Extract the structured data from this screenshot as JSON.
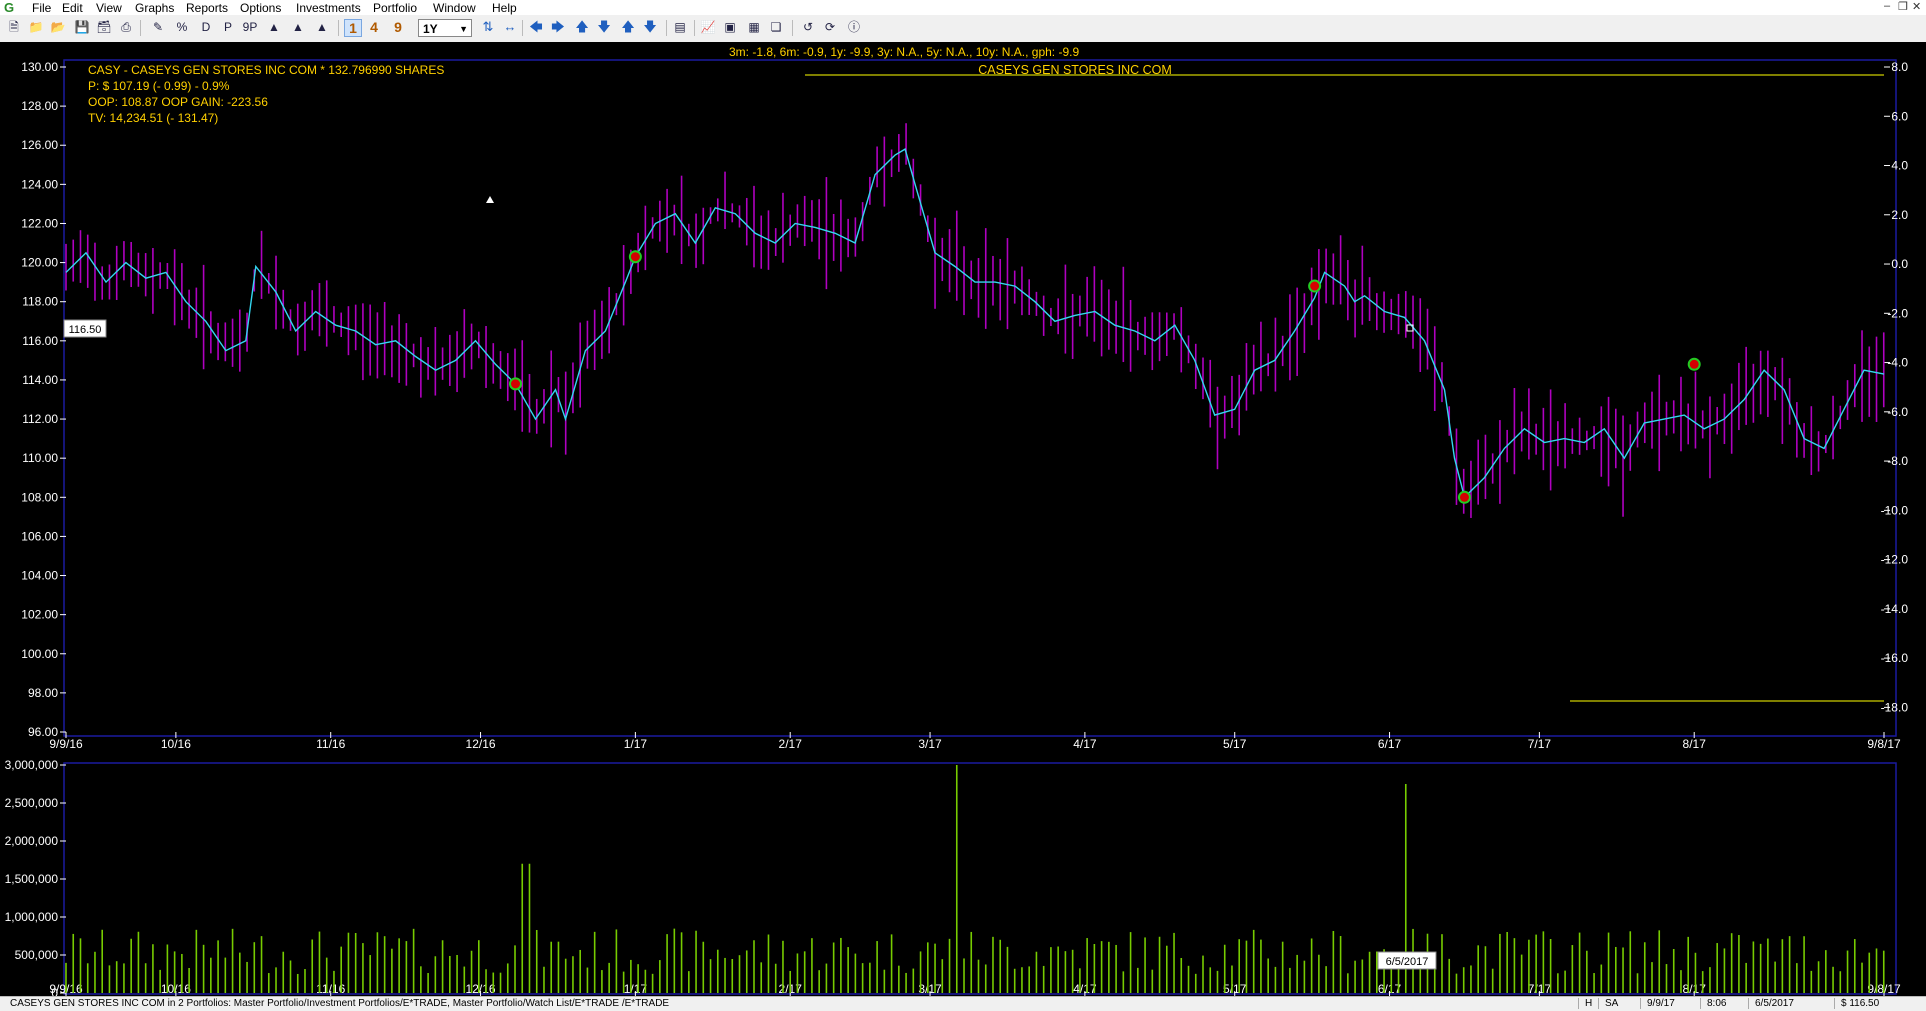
{
  "menu": {
    "items": [
      "File",
      "Edit",
      "View",
      "Graphs",
      "Reports",
      "Options",
      "Investments",
      "Portfolio",
      "Window",
      "Help"
    ],
    "logo": "G"
  },
  "toolbar": {
    "period_buttons": [
      "1",
      "4",
      "9"
    ],
    "period_select": "1Y"
  },
  "header": {
    "returns_line": "3m: -1.8,    6m: -0.9,    1y: -9.9,    3y: N.A.,    5y: N.A.,    10y: N.A.,    gph: -9.9",
    "security_title": "CASEYS GEN STORES INC COM",
    "info_line1": "CASY - CASEYS GEN STORES INC COM * 132.796990 SHARES",
    "info_line2": "P: $ 107.19 (- 0.99)  - 0.9%",
    "info_line3": "OOP:  108.87  OOP GAIN: -223.56",
    "info_line4": "TV: 14,234.51 (- 131.47)"
  },
  "price_label": "116.50",
  "date_label": "6/5/2017",
  "chart_data": {
    "type": "line",
    "title": "CASEYS GEN STORES INC COM",
    "left_axis_ticks": [
      "130.00",
      "128.00",
      "126.00",
      "124.00",
      "122.00",
      "120.00",
      "118.00",
      "116.00",
      "114.00",
      "112.00",
      "110.00",
      "108.00",
      "106.00",
      "104.00",
      "102.00",
      "100.00",
      "98.00",
      "96.00"
    ],
    "right_axis_ticks": [
      "8.0",
      "6.0",
      "4.0",
      "2.0",
      "0.0",
      "-2.0",
      "-4.0",
      "-6.0",
      "-8.0",
      "-10.0",
      "-12.0",
      "-14.0",
      "-16.0",
      "-18.0"
    ],
    "x_ticks": [
      "9/9/16",
      "10/16",
      "11/16",
      "12/16",
      "1/17",
      "2/17",
      "3/17",
      "4/17",
      "5/17",
      "6/17",
      "7/17",
      "8/17",
      "9/8/17"
    ],
    "volume_ticks": [
      "3,000,000",
      "2,500,000",
      "2,000,000",
      "1,500,000",
      "1,000,000",
      "500,000",
      "0"
    ],
    "ylim": [
      96,
      130
    ],
    "right_ylim": [
      -19,
      8
    ],
    "volume_ylim": [
      0,
      3000000
    ],
    "day_range": [
      0,
      364
    ],
    "price_series": {
      "name": "CASY",
      "points": [
        [
          0,
          119.5
        ],
        [
          4,
          120.5
        ],
        [
          8,
          119.0
        ],
        [
          12,
          120.0
        ],
        [
          16,
          119.2
        ],
        [
          20,
          119.5
        ],
        [
          24,
          118.0
        ],
        [
          28,
          117.0
        ],
        [
          32,
          115.5
        ],
        [
          36,
          116.0
        ],
        [
          38,
          119.8
        ],
        [
          42,
          118.5
        ],
        [
          46,
          116.5
        ],
        [
          50,
          117.5
        ],
        [
          54,
          116.8
        ],
        [
          58,
          116.5
        ],
        [
          62,
          115.8
        ],
        [
          66,
          116.0
        ],
        [
          70,
          115.2
        ],
        [
          74,
          114.5
        ],
        [
          78,
          115.0
        ],
        [
          82,
          116.0
        ],
        [
          86,
          114.8
        ],
        [
          90,
          113.8
        ],
        [
          94,
          112.0
        ],
        [
          98,
          113.5
        ],
        [
          100,
          112.0
        ],
        [
          104,
          115.5
        ],
        [
          108,
          116.5
        ],
        [
          112,
          119.0
        ],
        [
          114,
          120.3
        ],
        [
          118,
          122.0
        ],
        [
          122,
          122.5
        ],
        [
          126,
          121.0
        ],
        [
          130,
          122.8
        ],
        [
          134,
          122.5
        ],
        [
          138,
          121.5
        ],
        [
          142,
          121.0
        ],
        [
          146,
          122.0
        ],
        [
          150,
          121.8
        ],
        [
          154,
          121.5
        ],
        [
          158,
          121.0
        ],
        [
          162,
          124.5
        ],
        [
          166,
          125.5
        ],
        [
          168,
          125.8
        ],
        [
          170,
          124.0
        ],
        [
          174,
          120.5
        ],
        [
          178,
          119.8
        ],
        [
          182,
          119.0
        ],
        [
          186,
          119.0
        ],
        [
          190,
          118.8
        ],
        [
          194,
          118.0
        ],
        [
          198,
          117.0
        ],
        [
          202,
          117.3
        ],
        [
          206,
          117.5
        ],
        [
          210,
          116.8
        ],
        [
          214,
          116.5
        ],
        [
          218,
          116.0
        ],
        [
          222,
          116.8
        ],
        [
          226,
          115.0
        ],
        [
          230,
          112.2
        ],
        [
          234,
          112.5
        ],
        [
          238,
          114.5
        ],
        [
          242,
          115.0
        ],
        [
          246,
          116.5
        ],
        [
          250,
          118.2
        ],
        [
          252,
          119.5
        ],
        [
          256,
          118.8
        ],
        [
          258,
          118.0
        ],
        [
          260,
          118.3
        ],
        [
          264,
          117.5
        ],
        [
          268,
          117.2
        ],
        [
          272,
          116.0
        ],
        [
          276,
          113.5
        ],
        [
          278,
          110.0
        ],
        [
          280,
          108.0
        ],
        [
          284,
          109.0
        ],
        [
          288,
          110.5
        ],
        [
          292,
          111.5
        ],
        [
          296,
          110.8
        ],
        [
          300,
          111.0
        ],
        [
          304,
          110.8
        ],
        [
          308,
          111.5
        ],
        [
          312,
          110.0
        ],
        [
          316,
          111.8
        ],
        [
          320,
          112.0
        ],
        [
          324,
          112.2
        ],
        [
          328,
          111.5
        ],
        [
          332,
          112.0
        ],
        [
          336,
          113.0
        ],
        [
          340,
          114.5
        ],
        [
          344,
          113.5
        ],
        [
          348,
          111.0
        ],
        [
          352,
          110.5
        ],
        [
          356,
          112.5
        ],
        [
          360,
          114.5
        ],
        [
          364,
          114.3
        ]
      ],
      "color": "#33d6f0"
    },
    "volume_series": {
      "name": "Volume",
      "color": "#77cc00"
    },
    "range_bars_color": "#b000c0",
    "zero_line_color": "#cccc00",
    "markers": [
      {
        "x": 90,
        "y": 113.8
      },
      {
        "x": 114,
        "y": 120.3
      },
      {
        "x": 250,
        "y": 118.8
      },
      {
        "x": 280,
        "y": 108.0
      },
      {
        "x": 326,
        "y": 114.8
      }
    ],
    "annotations": [
      "116.50",
      "6/5/2017"
    ]
  },
  "status": {
    "text": "CASEYS GEN STORES INC COM in 2 Portfolios: Master Portfolio/Investment Portfolios/E*TRADE, Master Portfolio/Watch List/E*TRADE /E*TRADE",
    "cells": [
      "H",
      "SA",
      "9/9/17",
      "8:06",
      "6/5/2017",
      "$ 116.50"
    ]
  }
}
